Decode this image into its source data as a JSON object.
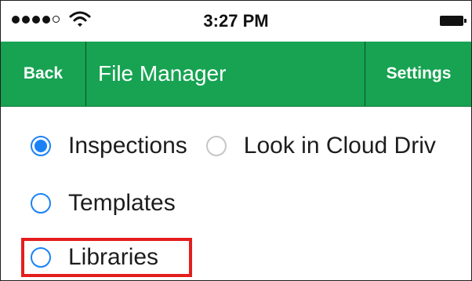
{
  "status_bar": {
    "time": "3:27 PM",
    "icons": [
      "signal-dots-icon",
      "wifi-icon",
      "battery-icon"
    ]
  },
  "nav": {
    "back_label": "Back",
    "title": "File Manager",
    "settings_label": "Settings",
    "bar_color": "#17a352"
  },
  "options": [
    {
      "label": "Inspections",
      "selected": true
    },
    {
      "label": "Look in Cloud Driv",
      "selected": false
    },
    {
      "label": "Templates",
      "selected": false
    },
    {
      "label": "Libraries",
      "selected": false
    }
  ],
  "colors": {
    "radio_accent": "#1a82f7",
    "highlight": "#e41d1d"
  }
}
